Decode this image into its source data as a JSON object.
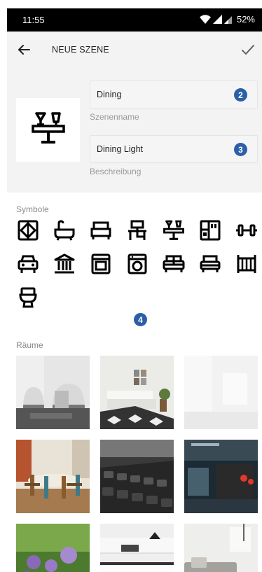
{
  "status_bar": {
    "time": "11:55",
    "battery": "52%"
  },
  "appbar": {
    "title": "NEUE SZENE",
    "back_icon": "arrow-left-icon",
    "confirm_icon": "checkmark-icon"
  },
  "scene": {
    "name_value": "Dining",
    "name_caption": "Szenenname",
    "description_value": "Dining Light",
    "description_caption": "Beschreibung",
    "preview_icon": "dining-table-icon"
  },
  "badges": {
    "name": "2",
    "description": "3",
    "symbols": "4"
  },
  "symbols": {
    "label": "Symbole",
    "items": [
      "kitchen-window-icon",
      "bathtub-icon",
      "bed-icon",
      "desk-icon",
      "dining-table-icon",
      "fridge-icon",
      "dumbbell-icon",
      "car-icon",
      "building-icon",
      "oven-icon",
      "washing-machine-icon",
      "sofa-icon",
      "armchair-icon",
      "crib-icon",
      "toilet-icon"
    ]
  },
  "rooms": {
    "label": "Räume",
    "items": [
      "hallway-arches",
      "bedroom-rug",
      "white-room",
      "dining-room",
      "gym-dumbbells",
      "garage-car",
      "garden-flowers",
      "kitchen-white",
      "living-room-sofa"
    ]
  },
  "colors": {
    "accent": "#2d5fa8",
    "appbar_bg": "#f3f3f3",
    "status_bg": "#000000"
  }
}
